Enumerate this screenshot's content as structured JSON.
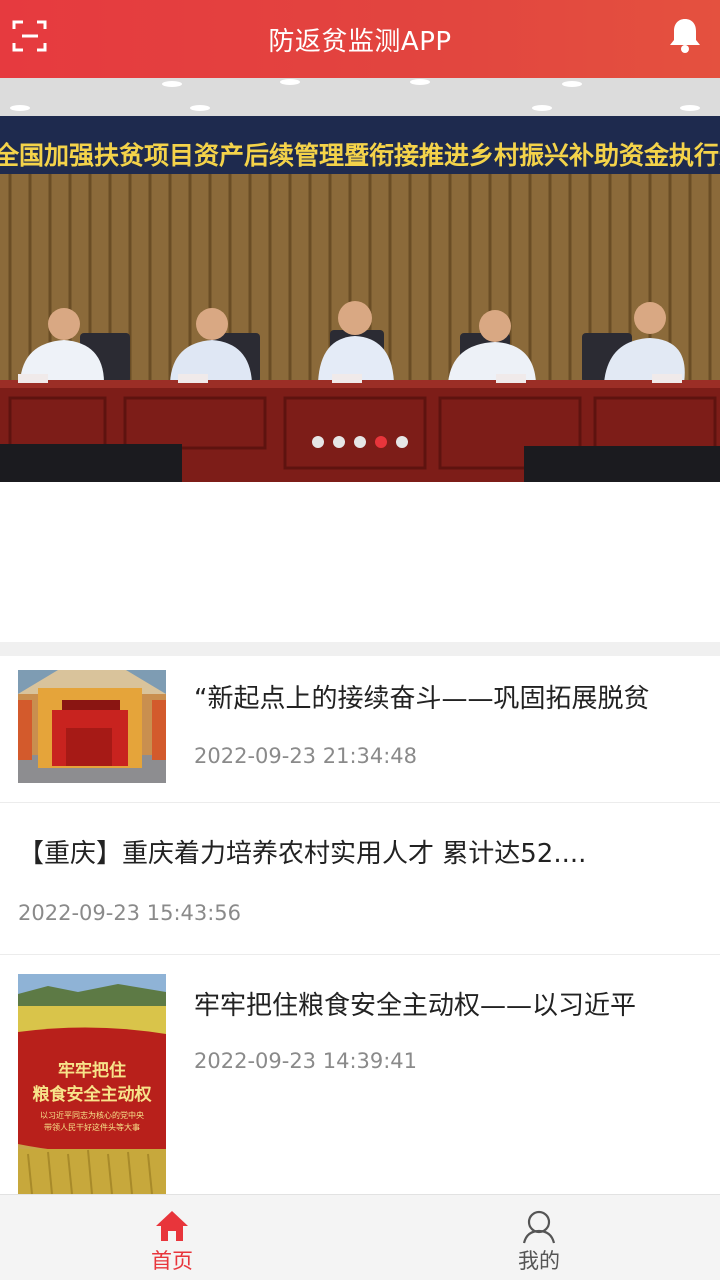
{
  "header": {
    "title": "防返贫监测APP",
    "accent": "#e63a3f"
  },
  "banner": {
    "caption": "全国加强扶贫项目资产后续管理暨衔接推进乡村振兴补助资金执行进度调度视频会议",
    "slide_count": 5,
    "active_slide": 4
  },
  "news": [
    {
      "title": "“新起点上的接续奋斗——巩固拓展脱贫",
      "time": "2022-09-23 21:34:48",
      "has_image": true
    },
    {
      "title": "【重庆】重庆着力培养农村实用人才 累计达52....",
      "time": "2022-09-23 15:43:56",
      "has_image": false
    },
    {
      "title": "牢牢把住粮食安全主动权——以习近平",
      "time": "2022-09-23 14:39:41",
      "has_image": true,
      "image_text": {
        "line1": "牢牢把住",
        "line2": "粮食安全主动权",
        "line3": "以习近平同志为核心的党中央",
        "line4": "带领人民干好这件头等大事"
      }
    }
  ],
  "tabs": [
    {
      "label": "首页",
      "icon": "home-icon",
      "active": true
    },
    {
      "label": "我的",
      "icon": "person-icon",
      "active": false
    }
  ],
  "colors": {
    "active_tab": "#e8353b",
    "inactive_tab": "#555555"
  }
}
